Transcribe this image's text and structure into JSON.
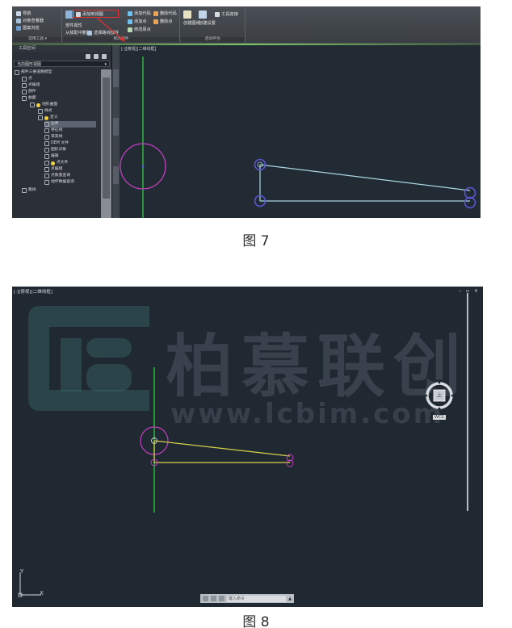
{
  "figure7": {
    "caption": "图 7",
    "ribbon": {
      "groups": [
        {
          "title": "常用工具 ▾",
          "buttons": [
            "导航",
            "对象查看器",
            "图案浏览"
          ]
        },
        {
          "title": "修改部件",
          "buttons": [
            "添加到视图",
            "部件属性",
            "从装配中删除",
            "选择路线部件"
          ]
        },
        {
          "title": "",
          "buttons": [
            "添加代码",
            "删除代码",
            "添加点",
            "删除点",
            "修改原点"
          ]
        },
        {
          "title": "启动平台",
          "buttons": [
            "创建图纸",
            "创建设置",
            "工具连接"
          ]
        }
      ]
    },
    "toolspace": {
      "title": "工具空间",
      "dropdown": "当前图形视图",
      "tree": [
        "部件三维道路模型",
        "点",
        "点编组",
        "部件",
        "曲面",
        "地形曲面",
        "样式",
        "定义",
        "边界",
        "特征线",
        "等高线",
        "DEM 文件",
        "图形对象",
        "编辑",
        "点文件",
        "点编组",
        "点数量查询",
        "地坪数据查询",
        "路线"
      ]
    },
    "viewport_label": "[-][俯视][二维线框]"
  },
  "figure8": {
    "caption": "图 8",
    "viewport_label": "[-][俯视][二维线框]",
    "window_controls": "– ▫ ×",
    "watermark_name": "柏慕联创",
    "watermark_url": "www.lcbim.com",
    "nav_cube_label": "上",
    "nav_label": "WCS",
    "ucs_y": "Y",
    "ucs_x": "X",
    "command_prompt": "键入命令"
  },
  "colors": {
    "viewport_bg": "#222a33",
    "magenta_circle": "#c23fc0",
    "cyan_line": "#a9d6df",
    "yellow_line": "#d7d24a",
    "green_axis": "#2fc23a",
    "grip_blue": "#5b57d8",
    "highlight_red": "#e23030"
  }
}
